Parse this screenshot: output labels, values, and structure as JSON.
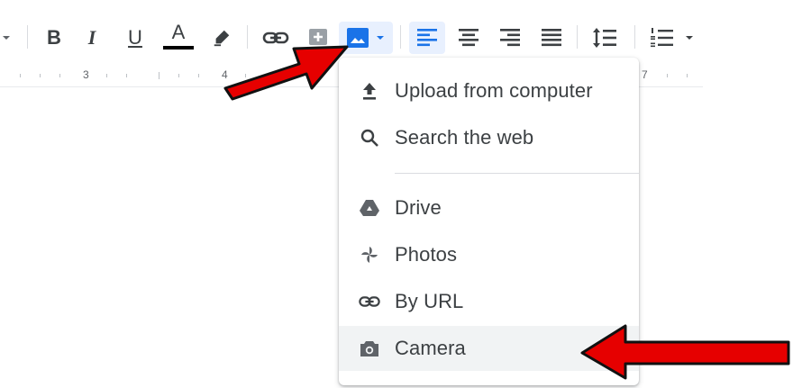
{
  "toolbar": {
    "ruler_numbers": [
      "3",
      "4",
      "7"
    ],
    "buttons": [
      {
        "name": "bold-button",
        "label": "B"
      },
      {
        "name": "italic-button",
        "label": "I"
      },
      {
        "name": "underline-button",
        "label": "U"
      },
      {
        "name": "text-color-button",
        "label": "A"
      }
    ],
    "text_color_bar": "#000000",
    "image_button_color": "#1a73e8"
  },
  "insert_image_menu": {
    "items": [
      {
        "label": "Upload from computer",
        "icon": "upload-icon"
      },
      {
        "label": "Search the web",
        "icon": "search-icon"
      },
      {
        "label": "Drive",
        "icon": "drive-icon"
      },
      {
        "label": "Photos",
        "icon": "photos-icon"
      },
      {
        "label": "By URL",
        "icon": "link-icon"
      },
      {
        "label": "Camera",
        "icon": "camera-icon"
      }
    ],
    "highlighted_item": "Camera"
  },
  "annotations": {
    "arrow_color": "#e60000",
    "arrows": [
      "arrow-to-image-button",
      "arrow-to-camera"
    ]
  }
}
